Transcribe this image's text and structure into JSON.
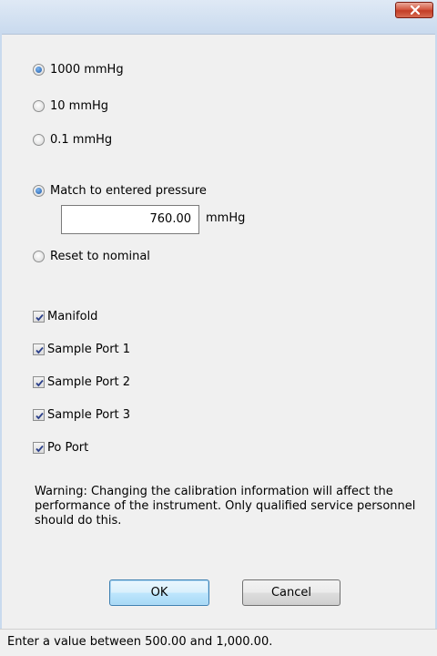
{
  "window": {
    "title": ""
  },
  "range_options": [
    {
      "label": "1000 mmHg",
      "checked": true
    },
    {
      "label": "10 mmHg",
      "checked": false
    },
    {
      "label": "0.1 mmHg",
      "checked": false
    }
  ],
  "calibration": {
    "match_label": "Match to entered pressure",
    "match_checked": true,
    "pressure_value": "760.00",
    "pressure_unit": "mmHg",
    "reset_label": "Reset to nominal",
    "reset_checked": false
  },
  "ports": [
    {
      "label": "Manifold",
      "checked": true
    },
    {
      "label": "Sample Port 1",
      "checked": true
    },
    {
      "label": "Sample Port 2",
      "checked": true
    },
    {
      "label": "Sample Port 3",
      "checked": true
    },
    {
      "label": "Po Port",
      "checked": true
    }
  ],
  "warning_text": "Warning: Changing the calibration information will affect the performance of the instrument. Only qualified service personnel should do this.",
  "buttons": {
    "ok": "OK",
    "cancel": "Cancel"
  },
  "status_text": "Enter a value between 500.00 and 1,000.00.",
  "colors": {
    "accent": "#1d5aa8",
    "close": "#c33d26",
    "default_button_border": "#3c7fb1"
  }
}
